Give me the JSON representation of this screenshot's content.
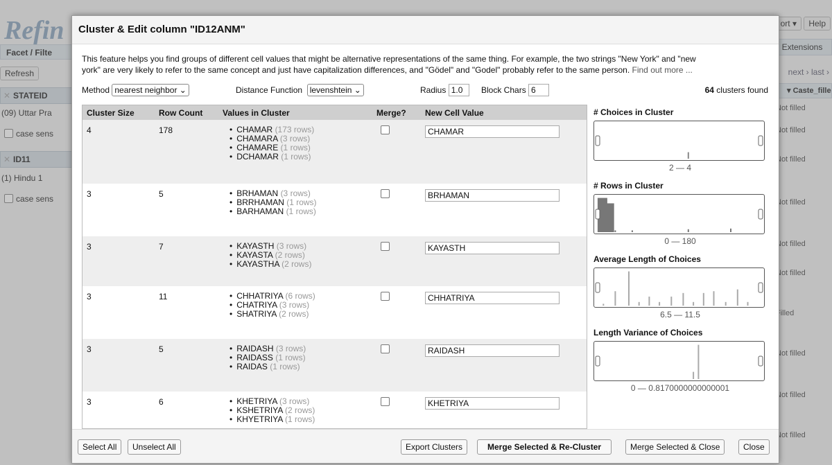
{
  "background": {
    "logo": "Refin",
    "facet_tab": "Facet / Filte",
    "refresh": "Refresh",
    "facets": [
      {
        "name": "STATEID",
        "value": "(09) Uttar Pra",
        "option": "case sens"
      },
      {
        "name": "ID11",
        "value": "(1) Hindu 1",
        "option": "case sens"
      }
    ],
    "top_right": {
      "export": "ort ▾",
      "help": "Help"
    },
    "extensions": "Extensions",
    "pager": "next › last ›",
    "column_header": "Caste_fille",
    "cells": [
      "Not filled",
      "Not filled",
      "Not filled",
      "Not filled",
      "Not filled",
      "Not filled",
      "Filled",
      "Not filled",
      "Not filled",
      "Not filled"
    ]
  },
  "dialog": {
    "title": "Cluster & Edit column \"ID12ANM\"",
    "description_line1": "This feature helps you find groups of different cell values that might be alternative representations of the same thing. For example, the two strings \"New York\" and \"new",
    "description_line2": "york\" are very likely to refer to the same concept and just have capitalization differences, and \"Gödel\" and \"Godel\" probably refer to the same person.",
    "find_out_more": "Find out more ...",
    "method_label": "Method",
    "method_value": "nearest neighbor",
    "distance_label": "Distance Function",
    "distance_value": "levenshtein",
    "radius_label": "Radius",
    "radius_value": "1.0",
    "block_chars_label": "Block Chars",
    "block_chars_value": "6",
    "clusters_count": "64",
    "clusters_found_label": "clusters found",
    "columns": [
      "Cluster Size",
      "Row Count",
      "Values in Cluster",
      "Merge?",
      "New Cell Value"
    ],
    "clusters": [
      {
        "size": "4",
        "rows": "178",
        "new_value": "CHAMAR",
        "values": [
          {
            "v": "CHAMAR",
            "c": "(173 rows)"
          },
          {
            "v": "CHAMARA",
            "c": "(3 rows)"
          },
          {
            "v": "CHAMARE",
            "c": "(1 rows)"
          },
          {
            "v": "DCHAMAR",
            "c": "(1 rows)"
          }
        ]
      },
      {
        "size": "3",
        "rows": "5",
        "new_value": "BRHAMAN",
        "values": [
          {
            "v": "BRHAMAN",
            "c": "(3 rows)"
          },
          {
            "v": "BRRHAMAN",
            "c": "(1 rows)"
          },
          {
            "v": "BARHAMAN",
            "c": "(1 rows)"
          }
        ]
      },
      {
        "size": "3",
        "rows": "7",
        "new_value": "KAYASTH",
        "values": [
          {
            "v": "KAYASTH",
            "c": "(3 rows)"
          },
          {
            "v": "KAYASTA",
            "c": "(2 rows)"
          },
          {
            "v": "KAYASTHA",
            "c": "(2 rows)"
          }
        ]
      },
      {
        "size": "3",
        "rows": "11",
        "new_value": "CHHATRIYA",
        "values": [
          {
            "v": "CHHATRIYA",
            "c": "(6 rows)"
          },
          {
            "v": "CHATRIYA",
            "c": "(3 rows)"
          },
          {
            "v": "SHATRIYA",
            "c": "(2 rows)"
          }
        ]
      },
      {
        "size": "3",
        "rows": "5",
        "new_value": "RAIDASH",
        "values": [
          {
            "v": "RAIDASH",
            "c": "(3 rows)"
          },
          {
            "v": "RAIDASS",
            "c": "(1 rows)"
          },
          {
            "v": "RAIDAS",
            "c": "(1 rows)"
          }
        ]
      },
      {
        "size": "3",
        "rows": "6",
        "new_value": "KHETRIYA",
        "values": [
          {
            "v": "KHETRIYA",
            "c": "(3 rows)"
          },
          {
            "v": "KSHETRIYA",
            "c": "(2 rows)"
          },
          {
            "v": "KHYETRIYA",
            "c": "(1 rows)"
          }
        ]
      }
    ],
    "charts": [
      {
        "title": "# Choices in Cluster",
        "range": "2 — 4",
        "bars": [
          0,
          0,
          0,
          0,
          0,
          0,
          0,
          0,
          0,
          0,
          0,
          0,
          0,
          0,
          0,
          0,
          0,
          0,
          0,
          0,
          0,
          0,
          0,
          0,
          0,
          0,
          0,
          0,
          0,
          0,
          0,
          0,
          0,
          0,
          0,
          0,
          0,
          0,
          0,
          0,
          0,
          0,
          0,
          0,
          0,
          0,
          0,
          0,
          0,
          0,
          0,
          0,
          0,
          0,
          0,
          0,
          0,
          0,
          0,
          0,
          0,
          0,
          0,
          0,
          0,
          0,
          0,
          0,
          0,
          0,
          0,
          0,
          0,
          0,
          0,
          0,
          0,
          0,
          0,
          0,
          0,
          0,
          0,
          0,
          0,
          0,
          0,
          0,
          0,
          0,
          0,
          0,
          0,
          0,
          0,
          0,
          0,
          0,
          0,
          0,
          0,
          0,
          0,
          0,
          0,
          0,
          0,
          0,
          0,
          0,
          0,
          0,
          0,
          0,
          0,
          0,
          0,
          0,
          0,
          0,
          0,
          0,
          0,
          0,
          0,
          0,
          0,
          0,
          0,
          0
        ],
        "marks": [
          0.55
        ],
        "mark_heights": [
          0.18
        ],
        "fill": "#888888"
      },
      {
        "title": "# Rows in Cluster",
        "range": "0 — 180",
        "marks": [
          0.02,
          0.06,
          0.12,
          0.22,
          0.55,
          0.8
        ],
        "mark_heights": [
          0.95,
          0.8,
          0.05,
          0.05,
          0.08,
          0.1
        ],
        "fill": "#777777"
      },
      {
        "title": "Average Length of Choices",
        "range": "6.5 — 11.5",
        "marks": [
          0.05,
          0.12,
          0.2,
          0.26,
          0.32,
          0.38,
          0.45,
          0.52,
          0.58,
          0.64,
          0.7,
          0.77,
          0.84,
          0.9
        ],
        "mark_heights": [
          0.05,
          0.4,
          0.95,
          0.1,
          0.25,
          0.1,
          0.25,
          0.35,
          0.1,
          0.35,
          0.4,
          0.1,
          0.45,
          0.1
        ],
        "fill": "#aaaaaa"
      },
      {
        "title": "Length Variance of Choices",
        "range": "0 — 0.8170000000000001",
        "marks": [
          0.58,
          0.61
        ],
        "mark_heights": [
          0.2,
          0.95
        ],
        "fill": "#aaaaaa"
      }
    ],
    "footer": {
      "select_all": "Select All",
      "unselect_all": "Unselect All",
      "export_clusters": "Export Clusters",
      "merge_recluster": "Merge Selected & Re-Cluster",
      "merge_close": "Merge Selected & Close",
      "close": "Close"
    }
  }
}
